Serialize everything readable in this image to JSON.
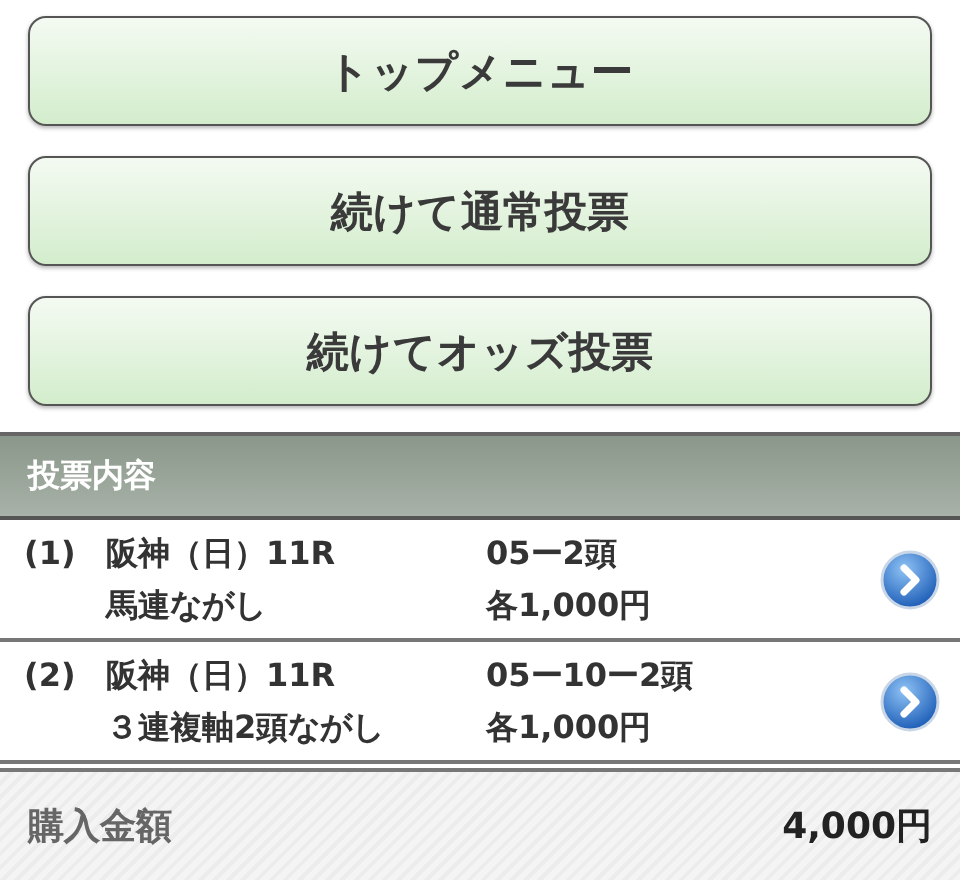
{
  "buttons": [
    {
      "label": "トップメニュー"
    },
    {
      "label": "続けて通常投票"
    },
    {
      "label": "続けてオッズ投票"
    }
  ],
  "section": {
    "title": "投票内容"
  },
  "tickets": [
    {
      "number": "(1)",
      "race": "阪神（日）11R",
      "type": "馬連ながし",
      "combination": "05ー2頭",
      "amount": "各1,000円"
    },
    {
      "number": "(2)",
      "race": "阪神（日）11R",
      "type": "３連複軸2頭ながし",
      "combination": "05ー10ー2頭",
      "amount": "各1,000円"
    }
  ],
  "total": {
    "label": "購入金額",
    "value": "4,000円"
  }
}
